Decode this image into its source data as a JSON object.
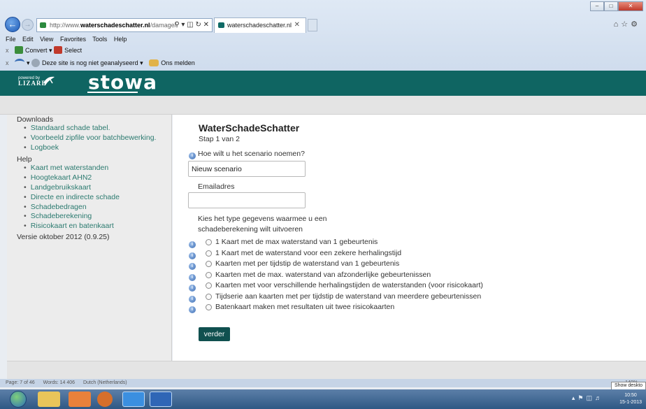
{
  "browser": {
    "url_prefix": "http://www.",
    "url_host": "waterschadeschatter.nl",
    "url_path": "/damage/",
    "tab_title": "waterschadeschatter.nl",
    "menu": [
      "File",
      "Edit",
      "View",
      "Favorites",
      "Tools",
      "Help"
    ],
    "cmd_convert": "Convert",
    "cmd_select": "Select",
    "cmd_site_status": "Deze site is nog niet geanalyseerd",
    "cmd_report": "Ons melden"
  },
  "header": {
    "powered_by": "powered by",
    "lizard": "LIZARD",
    "brand": "stowa"
  },
  "sidebar": {
    "downloads_heading": "Downloads",
    "downloads": [
      "Standaard schade tabel.",
      "Voorbeeld zipfile voor batchbewerking.",
      "Logboek"
    ],
    "help_heading": "Help",
    "help": [
      "Kaart met waterstanden",
      "Hoogtekaart AHN2",
      "Landgebruikskaart",
      "Directe en indirecte schade",
      "Schadebedragen",
      "Schadeberekening",
      "Risicokaart en batenkaart"
    ],
    "version": "Versie oktober 2012 (0.9.25)"
  },
  "main": {
    "title": "WaterSchadeSchatter",
    "step": "Stap 1 van 2",
    "scenario_question": "Hoe wilt u het scenario noemen?",
    "scenario_value": "Nieuw scenario",
    "email_label": "Emailadres",
    "email_value": "",
    "type_prompt": "Kies het type gegevens waarmee u een schadeberekening wilt uitvoeren",
    "options": [
      "1 Kaart met de max waterstand van 1 gebeurtenis",
      "1 Kaart met de waterstand voor een zekere herhalingstijd",
      "Kaarten met per tijdstip de waterstand van 1 gebeurtenis",
      "Kaarten met de max. waterstand van afzonderlijke gebeurtenissen",
      "Kaarten met voor verschillende herhalingstijden de waterstanden (voor risicokaart)",
      "Tijdserie aan kaarten met per tijdstip de waterstand van meerdere gebeurtenissen",
      "Batenkaart maken met resultaten uit twee risicokaarten"
    ],
    "submit": "verder"
  },
  "word_status": {
    "page": "Page: 7 of 46",
    "words": "Words: 14 406",
    "language": "Dutch (Netherlands)",
    "zoom": "140%",
    "show_desktop": "Show deskto"
  },
  "taskbar": {
    "time": "10:50",
    "date": "15-1-2013"
  },
  "colors": {
    "brand_teal": "#0f6562",
    "link_teal": "#2b7a6f",
    "button_teal": "#10504f"
  }
}
